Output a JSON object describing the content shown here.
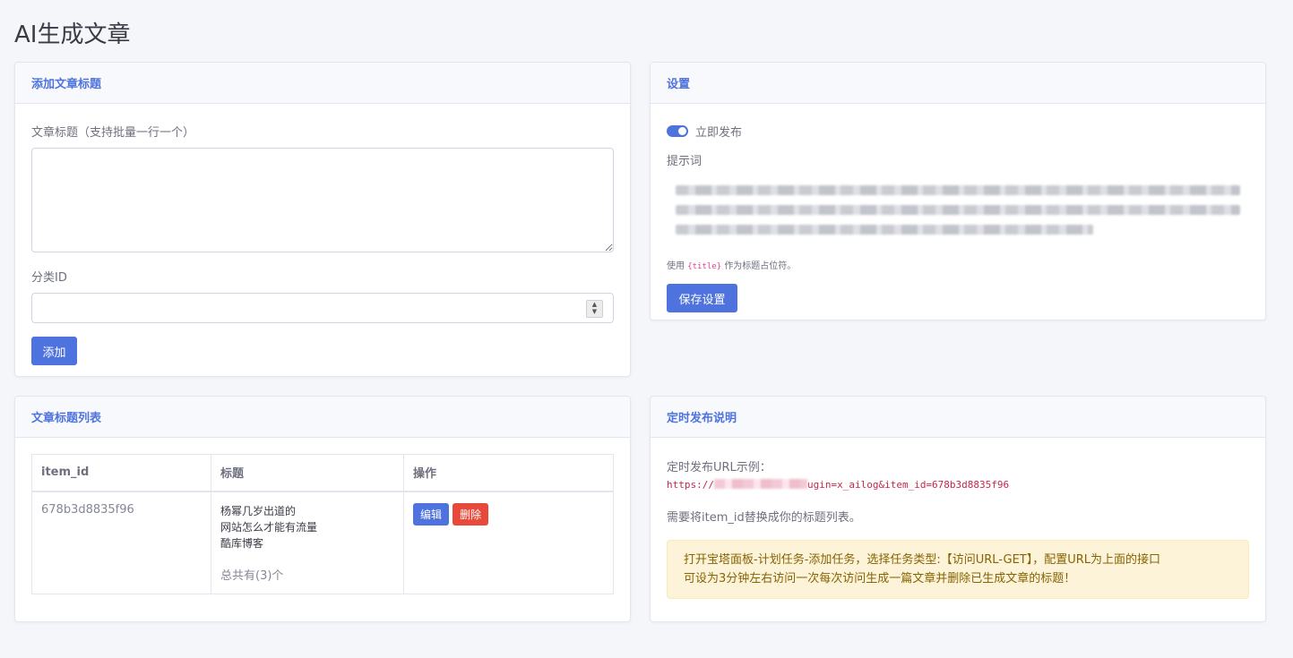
{
  "page": {
    "title": "AI生成文章"
  },
  "add_card": {
    "header": "添加文章标题",
    "title_label": "文章标题（支持批量一行一个）",
    "title_value": "",
    "category_label": "分类ID",
    "category_value": "",
    "add_button": "添加"
  },
  "settings_card": {
    "header": "设置",
    "publish_toggle_label": "立即发布",
    "publish_toggle_on": true,
    "prompt_label": "提示词",
    "hint_prefix": "使用",
    "hint_token": "{title}",
    "hint_suffix": "作为标题占位符。",
    "save_button": "保存设置"
  },
  "list_card": {
    "header": "文章标题列表",
    "columns": [
      "item_id",
      "标题",
      "操作"
    ],
    "rows": [
      {
        "item_id": "678b3d8835f96",
        "titles": [
          "杨幂几岁出道的",
          "网站怎么才能有流量",
          "酷库博客"
        ],
        "total": "总共有(3)个",
        "edit_label": "编辑",
        "delete_label": "删除"
      }
    ]
  },
  "schedule_card": {
    "header": "定时发布说明",
    "url_label": "定时发布URL示例：",
    "url_prefix": "https://",
    "url_suffix": "ugin=x_ailog&item_id=678b3d8835f96",
    "replace_note": "需要将item_id替换成你的标题列表。",
    "alert_line1": "打开宝塔面板-计划任务-添加任务，选择任务类型:【访问URL-GET】，配置URL为上面的接口",
    "alert_line2": "可设为3分钟左右访问一次每次访问生成一篇文章并删除已生成文章的标题！"
  },
  "colors": {
    "primary": "#4e73df",
    "danger": "#e74a3b",
    "warning_bg": "#fdf3d8",
    "warning_text": "#856404",
    "background": "#f5f6fa"
  },
  "icons": [
    "number-spinner-icon",
    "resize-handle-icon"
  ]
}
